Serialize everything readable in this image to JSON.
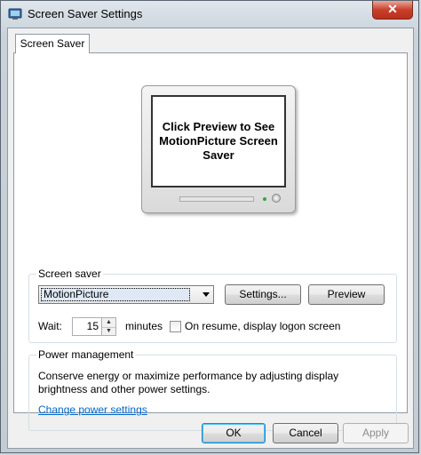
{
  "window": {
    "title": "Screen Saver Settings",
    "close_glyph": "✕",
    "icon": "screen-saver-settings-icon"
  },
  "tabs": [
    {
      "label": "Screen Saver",
      "selected": true
    }
  ],
  "preview": {
    "message": "Click Preview to See MotionPicture Screen Saver"
  },
  "screen_saver": {
    "group_label": "Screen saver",
    "selected": "MotionPicture",
    "settings_label": "Settings...",
    "preview_label": "Preview",
    "wait_label": "Wait:",
    "wait_value": "15",
    "minutes_label": "minutes",
    "resume_label": "On resume, display logon screen",
    "resume_checked": false
  },
  "power": {
    "group_label": "Power management",
    "description": "Conserve energy or maximize performance by adjusting display brightness and other power settings.",
    "link_label": "Change power settings"
  },
  "footer": {
    "ok_label": "OK",
    "cancel_label": "Cancel",
    "apply_label": "Apply"
  },
  "colors": {
    "link": "#0066cc",
    "close_button": "#c8402b",
    "default_button_focus": "#48c3f6"
  }
}
